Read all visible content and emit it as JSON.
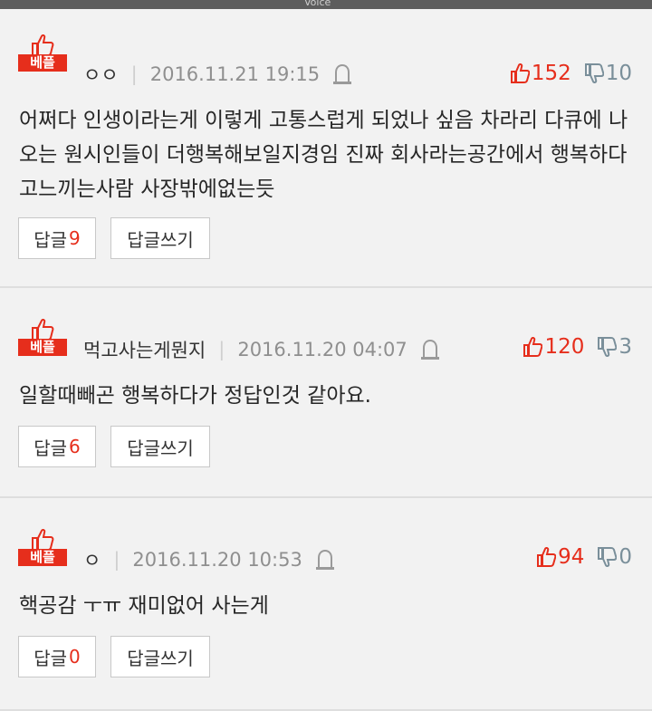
{
  "status_bar": {
    "voice_label": "Voice"
  },
  "colors": {
    "accent": "#e62e1c",
    "text": "#262626",
    "meta": "#8f8f8f",
    "down": "#7a8f9a"
  },
  "badge_label": "베플",
  "buttons": {
    "reply_label": "답글",
    "write_label": "답글쓰기"
  },
  "comments": [
    {
      "nickname": "ㅇㅇ",
      "timestamp": "2016.11.21 19:15",
      "upvotes": "152",
      "downvotes": "10",
      "text": "어쩌다 인생이라는게 이렇게 고통스럽게 되었나 싶음 차라리 다큐에 나오는 원시인들이 더행복해보일지경임 진짜 회사라는공간에서 행복하다고느끼는사람 사장밖에없는듯",
      "reply_count": "9"
    },
    {
      "nickname": "먹고사는게뭔지",
      "timestamp": "2016.11.20 04:07",
      "upvotes": "120",
      "downvotes": "3",
      "text": "일할때빼곤 행복하다가 정답인것 같아요.",
      "reply_count": "6"
    },
    {
      "nickname": "ㅇ",
      "timestamp": "2016.11.20 10:53",
      "upvotes": "94",
      "downvotes": "0",
      "text": "핵공감 ㅜㅠ 재미없어 사는게",
      "reply_count": "0"
    }
  ]
}
